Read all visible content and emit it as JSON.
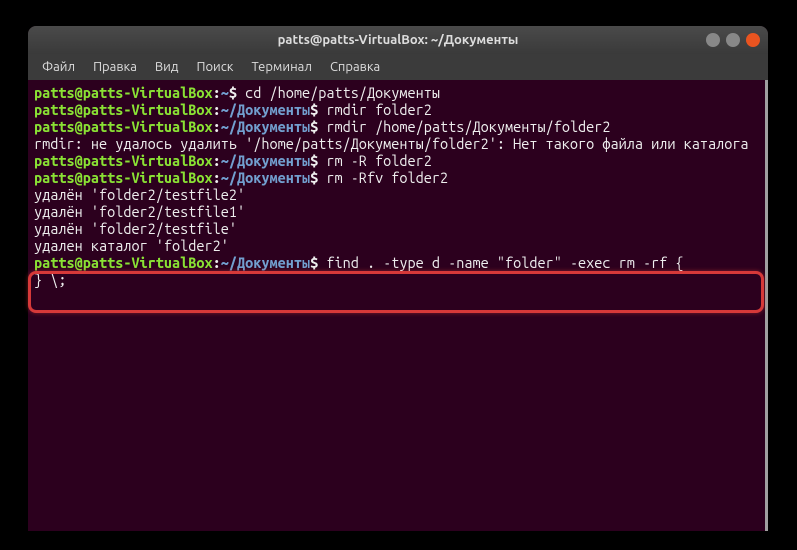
{
  "window": {
    "title": "patts@patts-VirtualBox: ~/Документы"
  },
  "menubar": {
    "items": [
      "Файл",
      "Правка",
      "Вид",
      "Поиск",
      "Терминал",
      "Справка"
    ]
  },
  "prompt": {
    "user_host": "patts@patts-VirtualBox",
    "home_path": "~",
    "docs_path": "~/Документы"
  },
  "lines": {
    "cmd1": "cd /home/patts/Документы",
    "cmd2": "rmdir folder2",
    "cmd3": "rmdir /home/patts/Документы/folder2",
    "out_err": "rmdir: не удалось удалить '/home/patts/Документы/folder2': Нет такого файла или каталога",
    "cmd4": "rm -R folder2",
    "cmd5": "rm -Rfv folder2",
    "out_d1": "удалён 'folder2/testfile2'",
    "out_d2": "удалён 'folder2/testfile1'",
    "out_d3": "удалён 'folder2/testfile'",
    "out_d4": "удален каталог 'folder2'",
    "cmd6a": "find . -type d -name \"folder\" -exec rm -rf {",
    "cmd6b": "} \\;"
  }
}
